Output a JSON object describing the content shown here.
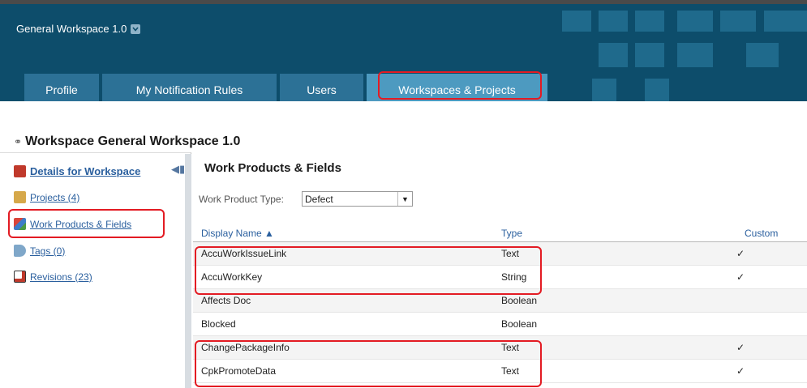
{
  "header": {
    "workspace_name": "General Workspace 1.0",
    "colors": {
      "banner": "#0d4d6b",
      "tab": "#2c7196",
      "tab_active": "#4d9ac0",
      "highlight": "#e31b23"
    }
  },
  "tabs": [
    {
      "label": "Profile"
    },
    {
      "label": "My Notification Rules"
    },
    {
      "label": "Users"
    },
    {
      "label": "Workspaces & Projects",
      "active": true
    }
  ],
  "page": {
    "title": "Workspace General Workspace 1.0"
  },
  "sidebar": {
    "items": [
      {
        "label": "Details for Workspace",
        "icon": "monitor-icon"
      },
      {
        "label": "Projects (4)",
        "icon": "folder-icon"
      },
      {
        "label": "Work Products & Fields",
        "icon": "hierarchy-icon"
      },
      {
        "label": "Tags (0)",
        "icon": "tag-icon"
      },
      {
        "label": "Revisions (23)",
        "icon": "notepad-icon"
      }
    ]
  },
  "main": {
    "title": "Work Products & Fields",
    "work_product_type_label": "Work Product Type:",
    "work_product_type_value": "Defect",
    "columns": [
      "Display Name ▲",
      "Type",
      "Custom"
    ],
    "rows": [
      {
        "name": "AccuWorkIssueLink",
        "type": "Text",
        "custom": "✓"
      },
      {
        "name": "AccuWorkKey",
        "type": "String",
        "custom": "✓"
      },
      {
        "name": "Affects Doc",
        "type": "Boolean",
        "custom": ""
      },
      {
        "name": "Blocked",
        "type": "Boolean",
        "custom": ""
      },
      {
        "name": "ChangePackageInfo",
        "type": "Text",
        "custom": "✓"
      },
      {
        "name": "CpkPromoteData",
        "type": "Text",
        "custom": "✓"
      }
    ]
  }
}
